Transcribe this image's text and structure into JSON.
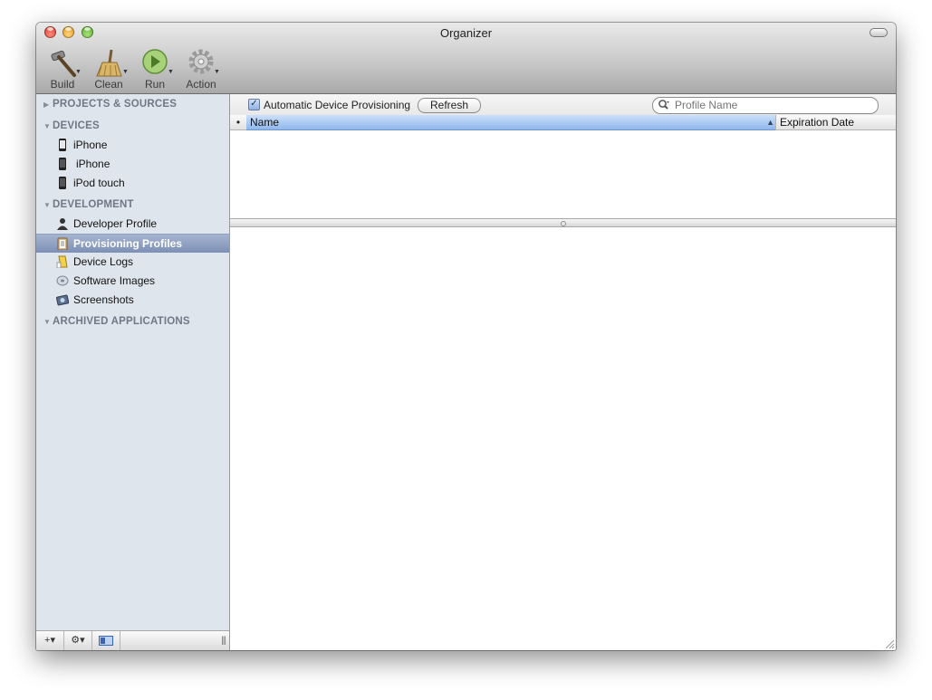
{
  "window": {
    "title": "Organizer"
  },
  "toolbar": {
    "build_label": "Build",
    "clean_label": "Clean",
    "run_label": "Run",
    "action_label": "Action"
  },
  "sidebar": {
    "sections": {
      "projects": "PROJECTS & SOURCES",
      "devices": "DEVICES",
      "development": "DEVELOPMENT",
      "archived": "ARCHIVED APPLICATIONS"
    },
    "devices": [
      "iPhone",
      "iPhone",
      "iPod touch"
    ],
    "development": [
      {
        "label": "Developer Profile",
        "icon": "person-icon"
      },
      {
        "label": "Provisioning Profiles",
        "icon": "clipboard-icon",
        "selected": true
      },
      {
        "label": "Device Logs",
        "icon": "console-log-icon"
      },
      {
        "label": "Software Images",
        "icon": "disk-image-icon"
      },
      {
        "label": "Screenshots",
        "icon": "camera-icon"
      }
    ],
    "bottom": {
      "add": "+▾",
      "gear": "⚙▾"
    }
  },
  "content": {
    "auto_provisioning_label": "Automatic Device Provisioning",
    "auto_provisioning_checked": true,
    "refresh_label": "Refresh",
    "search_placeholder": "Profile Name",
    "columns": {
      "dot": "•",
      "name": "Name",
      "expiration": "Expiration Date"
    }
  },
  "colors": {
    "selection": "#7d90b5",
    "sidebar_bg": "#dfe5ec",
    "column_highlight": "#8fb7ec"
  }
}
